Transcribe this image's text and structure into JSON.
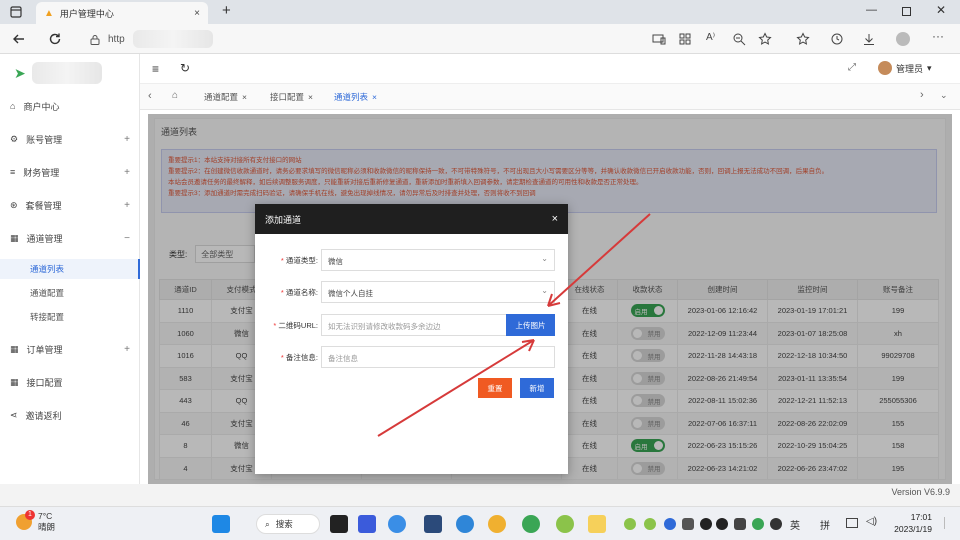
{
  "browser": {
    "tab_title": "用户管理中心",
    "new_tab": "+",
    "url": "http"
  },
  "header": {
    "user": "管理员"
  },
  "sidebar": {
    "items": [
      {
        "label": "商户中心",
        "icon": "home-icon"
      },
      {
        "label": "账号管理",
        "icon": "gear-icon",
        "expand": "+"
      },
      {
        "label": "财务管理",
        "icon": "list-icon",
        "expand": "+"
      },
      {
        "label": "套餐管理",
        "icon": "setting-icon",
        "expand": "+"
      },
      {
        "label": "通道管理",
        "icon": "grid-icon",
        "expand": "−"
      },
      {
        "label": "订单管理",
        "icon": "grid-icon",
        "expand": "+"
      },
      {
        "label": "接口配置",
        "icon": "grid-icon"
      },
      {
        "label": "邀请返利",
        "icon": "share-icon"
      }
    ],
    "sub_items": [
      "通道列表",
      "通道配置",
      "转接配置"
    ]
  },
  "navtabs": [
    {
      "label": "通道配置"
    },
    {
      "label": "接口配置"
    },
    {
      "label": "通道列表"
    }
  ],
  "page": {
    "title": "通道列表",
    "notices": [
      "重要提示1：本站支持对接所有支付接口的网站",
      "重要提示2：在创建微信收款通道时，请务必要求填写的微信昵称必须和收款微信的昵称保持一致，不可带特殊符号，不可出现且大小写需要区分等等，并确认收款微信已开启收款功能，否则，回调上报无法成功不回调，后果自负。",
      "本站会员邀请任务的最终解释，如后续调整服务调度，只能重新对接后重新修复通道，重新添加时重新填入回调参数，请定期检查通道的可用性和收款是否正常处理。",
      "重要提示3：添加通道时需完成扫码验证，请确保手机在线，避免出现掉线情况，请勿异常后及时排查并处理，否则将收不到回调"
    ],
    "filter_label": "类型:",
    "filter_value": "全部类型"
  },
  "table": {
    "headers": [
      "通道ID",
      "支付模式",
      "",
      "",
      "",
      "在线状态",
      "收款状态",
      "创建时间",
      "监控时间",
      "账号备注"
    ],
    "rows": [
      {
        "id": "1110",
        "mode": "支付宝",
        "online": "在线",
        "status": "启用",
        "on": true,
        "created": "2023-01-06 12:16:42",
        "monitor": "2023-01-19 17:01:21",
        "note": "199"
      },
      {
        "id": "1060",
        "mode": "微信",
        "online": "在线",
        "status": "禁用",
        "on": false,
        "created": "2022-12-09 11:23:44",
        "monitor": "2023-01-07 18:25:08",
        "note": "xh"
      },
      {
        "id": "1016",
        "mode": "QQ",
        "online": "在线",
        "status": "禁用",
        "on": false,
        "created": "2022-11-28 14:43:18",
        "monitor": "2022-12-18 10:34:50",
        "note": "99029708"
      },
      {
        "id": "583",
        "mode": "支付宝",
        "online": "在线",
        "status": "禁用",
        "on": false,
        "created": "2022-08-26 21:49:54",
        "monitor": "2023-01-11 13:35:54",
        "note": "199"
      },
      {
        "id": "443",
        "mode": "QQ",
        "online": "在线",
        "status": "禁用",
        "on": false,
        "created": "2022-08-11 15:02:36",
        "monitor": "2022-12-21 11:52:13",
        "note": "255055306"
      },
      {
        "id": "46",
        "mode": "支付宝",
        "online": "在线",
        "status": "禁用",
        "on": false,
        "created": "2022-07-06 16:37:11",
        "monitor": "2022-08-26 22:02:09",
        "note": "155"
      },
      {
        "id": "8",
        "mode": "微信",
        "online": "在线",
        "status": "启用",
        "on": true,
        "created": "2022-06-23 15:15:26",
        "monitor": "2022-10-29 15:04:25",
        "note": "158"
      },
      {
        "id": "4",
        "mode": "支付宝",
        "online": "在线",
        "status": "禁用",
        "on": false,
        "created": "2022-06-23 14:21:02",
        "monitor": "2022-06-26 23:47:02",
        "note": "195"
      }
    ]
  },
  "modal": {
    "title": "添加通道",
    "close": "×",
    "fields": [
      {
        "label": "通道类型:",
        "value": "微信",
        "required": "*"
      },
      {
        "label": "通道名称:",
        "value": "微信个人自挂",
        "required": "*"
      },
      {
        "label": "二维码URL:",
        "placeholder": "如无法识别请修改收款码多余边边",
        "required": "*"
      },
      {
        "label": "备注信息:",
        "placeholder": "备注信息",
        "required": "*"
      }
    ],
    "upload_button": "上传图片",
    "reset_button": "重置",
    "add_button": "新增"
  },
  "footer": {
    "version": "Version V6.9.9"
  },
  "taskbar": {
    "weather_temp": "7°C",
    "weather_desc": "晴朗",
    "weather_badge": "1",
    "search": "搜索",
    "lang1": "英",
    "lang2": "拼",
    "time": "17:01",
    "date": "2023/1/19"
  },
  "colors": {
    "accent": "#2f6ad8",
    "danger": "#f05a22",
    "success": "#3aa655",
    "notice_text": "#e05a3a",
    "annotation_arrow": "#d63a3a"
  }
}
